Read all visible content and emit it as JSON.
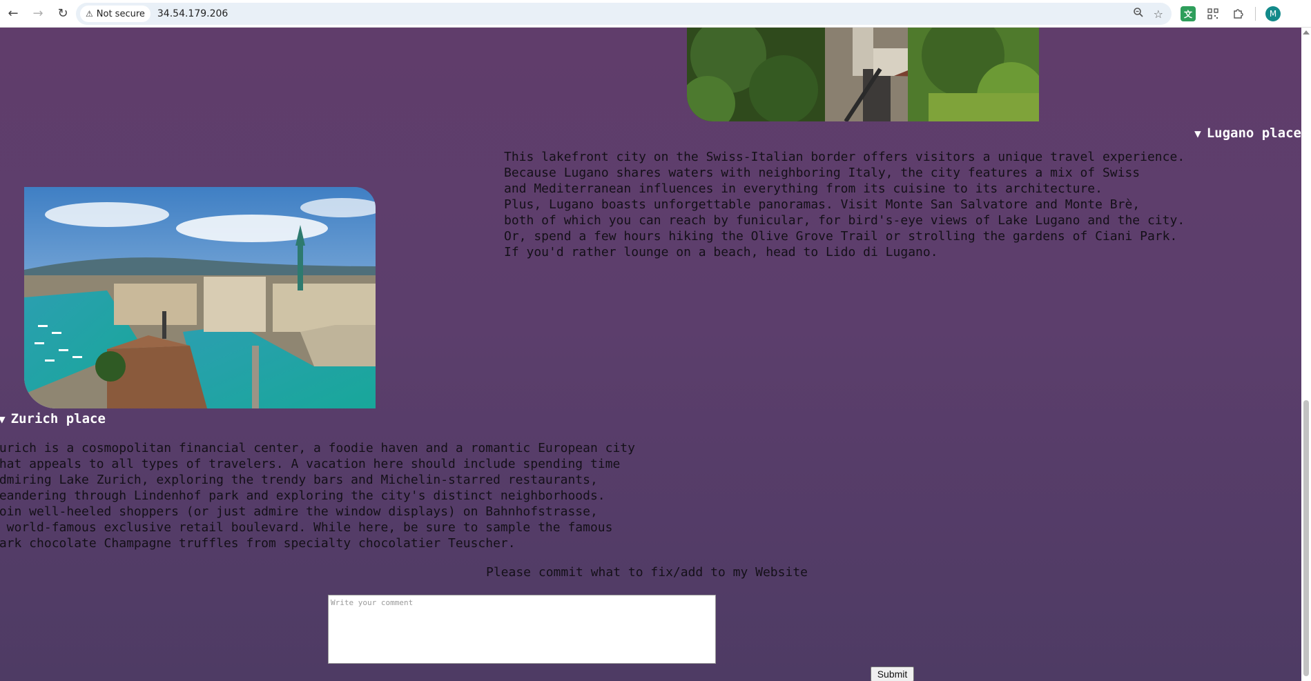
{
  "browser": {
    "security_label": "Not secure",
    "url": "34.54.179.206",
    "profile_initial": "M"
  },
  "icons": {
    "back": "back-arrow-icon",
    "forward": "forward-arrow-icon",
    "reload": "reload-icon",
    "warning": "warning-triangle-icon",
    "zoom": "zoom-icon",
    "bookmark": "star-icon",
    "translate": "translate-extension-icon",
    "qr": "qr-code-icon",
    "extensions": "puzzle-piece-icon"
  },
  "sections": {
    "lugano": {
      "summary": "Lugano place",
      "text": "This lakefront city on the Swiss-Italian border offers visitors a unique travel experience.\nBecause Lugano shares waters with neighboring Italy, the city features a mix of Swiss\nand Mediterranean influences in everything from its cuisine to its architecture.\nPlus, Lugano boasts unforgettable panoramas. Visit Monte San Salvatore and Monte Brè,\nboth of which you can reach by funicular, for bird's-eye views of Lake Lugano and the city.\nOr, spend a few hours hiking the Olive Grove Trail or strolling the gardens of Ciani Park.\nIf you'd rather lounge on a beach, head to Lido di Lugano."
    },
    "zurich": {
      "summary": "Zurich place",
      "text": "Zurich is a cosmopolitan financial center, a foodie haven and a romantic European city\nthat appeals to all types of travelers. A vacation here should include spending time\nadmiring Lake Zurich, exploring the trendy bars and Michelin-starred restaurants,\nmeandering through Lindenhof park and exploring the city's distinct neighborhoods.\nJoin well-heeled shoppers (or just admire the window displays) on Bahnhofstrasse,\na world-famous exclusive retail boulevard. While here, be sure to sample the famous\ndark chocolate Champagne truffles from specialty chocolatier Teuscher."
    }
  },
  "comment": {
    "prompt": "Please commit what to fix/add to my Website",
    "placeholder": "Write your comment",
    "submit_label": "Submit"
  }
}
